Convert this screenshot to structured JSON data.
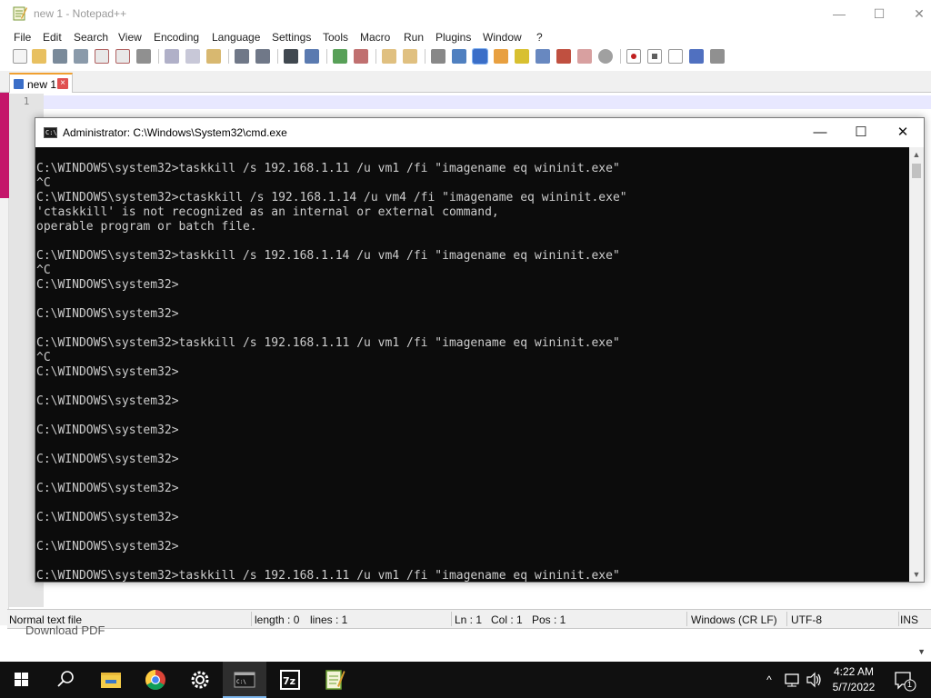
{
  "notepad": {
    "title": "new 1 - Notepad++",
    "menu": [
      "File",
      "Edit",
      "Search",
      "View",
      "Encoding",
      "Language",
      "Settings",
      "Tools",
      "Macro",
      "Run",
      "Plugins",
      "Window",
      "?"
    ],
    "tab_label": "new 1",
    "tab_close": "×",
    "line_number": "1",
    "status": {
      "file_type": "Normal text file",
      "length": "length : 0",
      "lines": "lines : 1",
      "ln": "Ln : 1",
      "col": "Col : 1",
      "pos": "Pos : 1",
      "eol": "Windows (CR LF)",
      "encoding": "UTF-8",
      "mode": "INS"
    },
    "partial_behind_text": "Download PDF"
  },
  "cmd": {
    "title": "Administrator: C:\\Windows\\System32\\cmd.exe",
    "lines": [
      "C:\\WINDOWS\\system32>taskkill /s 192.168.1.11 /u vm1 /fi \"imagename eq wininit.exe\"",
      "^C",
      "C:\\WINDOWS\\system32>ctaskkill /s 192.168.1.14 /u vm4 /fi \"imagename eq wininit.exe\"",
      "'ctaskkill' is not recognized as an internal or external command,",
      "operable program or batch file.",
      "",
      "C:\\WINDOWS\\system32>taskkill /s 192.168.1.14 /u vm4 /fi \"imagename eq wininit.exe\"",
      "^C",
      "C:\\WINDOWS\\system32>",
      "",
      "C:\\WINDOWS\\system32>",
      "",
      "C:\\WINDOWS\\system32>taskkill /s 192.168.1.11 /u vm1 /fi \"imagename eq wininit.exe\"",
      "^C",
      "C:\\WINDOWS\\system32>",
      "",
      "C:\\WINDOWS\\system32>",
      "",
      "C:\\WINDOWS\\system32>",
      "",
      "C:\\WINDOWS\\system32>",
      "",
      "C:\\WINDOWS\\system32>",
      "",
      "C:\\WINDOWS\\system32>",
      "",
      "C:\\WINDOWS\\system32>",
      "",
      "C:\\WINDOWS\\system32>taskkill /s 192.168.1.11 /u vm1 /fi \"imagename eq wininit.exe\""
    ],
    "controls": {
      "minimize": "—",
      "maximize": "☐",
      "close": "✕"
    }
  },
  "taskbar": {
    "apps": [
      "start-icon",
      "search-icon",
      "file-explorer-icon",
      "chrome-icon",
      "settings-icon",
      "cmd-icon",
      "7zip-icon",
      "notepadpp-icon"
    ],
    "tray_chevron": "^",
    "time": "4:22 AM",
    "date": "5/7/2022",
    "notification_count": "1"
  },
  "colors": {
    "console_bg": "#0c0c0c",
    "console_fg": "#cccccc",
    "taskbar_bg": "#101010",
    "current_line": "#e8e8ff",
    "tab_accent": "#f0a030"
  }
}
